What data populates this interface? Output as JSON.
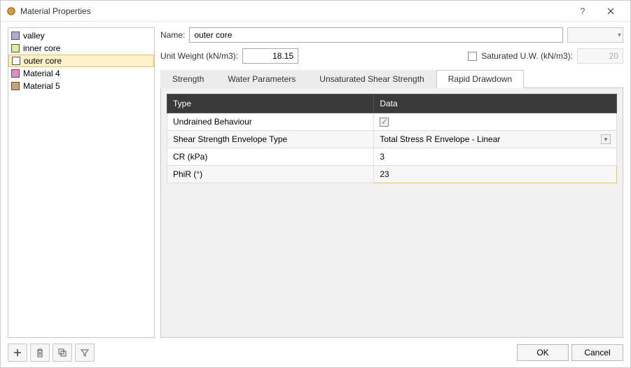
{
  "window": {
    "title": "Material Properties"
  },
  "materials": [
    {
      "name": "valley",
      "color": "#b6a8d6",
      "selected": false
    },
    {
      "name": "inner core",
      "color": "#d9f0a3",
      "selected": false
    },
    {
      "name": "outer core",
      "color": "#ffffff",
      "selected": true
    },
    {
      "name": "Material 4",
      "color": "#e38bc0",
      "selected": false
    },
    {
      "name": "Material 5",
      "color": "#c9a36a",
      "selected": false
    }
  ],
  "form": {
    "name_label": "Name:",
    "name_value": "outer core",
    "unit_weight_label": "Unit Weight (kN/m3):",
    "unit_weight_value": "18.15",
    "saturated_label": "Saturated U.W. (kN/m3):",
    "saturated_checked": false,
    "saturated_value": "20"
  },
  "tabs": {
    "items": [
      {
        "label": "Strength"
      },
      {
        "label": "Water Parameters"
      },
      {
        "label": "Unsaturated Shear Strength"
      },
      {
        "label": "Rapid Drawdown"
      }
    ],
    "active_index": 3
  },
  "grid": {
    "headers": {
      "type": "Type",
      "data": "Data"
    },
    "rows": [
      {
        "type": "Undrained Behaviour",
        "kind": "check",
        "value": "✓"
      },
      {
        "type": "Shear Strength Envelope Type",
        "kind": "select",
        "value": "Total Stress R Envelope - Linear"
      },
      {
        "type": "CR (kPa)",
        "kind": "text",
        "value": "3"
      },
      {
        "type": "PhiR (°)",
        "kind": "text",
        "value": "23",
        "editing": true
      }
    ]
  },
  "buttons": {
    "ok": "OK",
    "cancel": "Cancel"
  }
}
